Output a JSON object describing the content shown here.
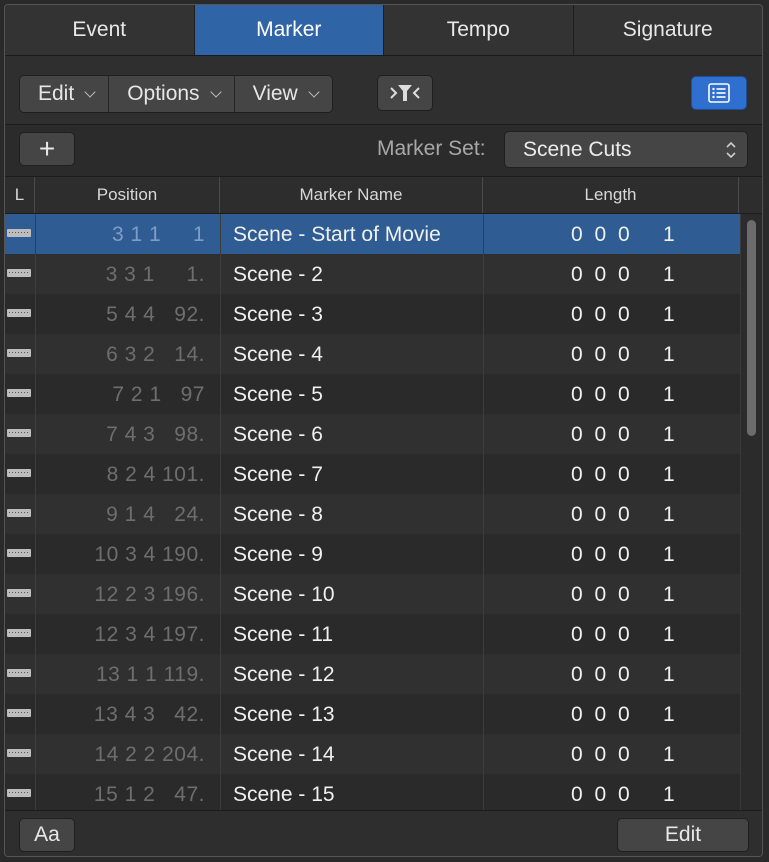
{
  "tabs": [
    {
      "label": "Event",
      "active": false
    },
    {
      "label": "Marker",
      "active": true
    },
    {
      "label": "Tempo",
      "active": false
    },
    {
      "label": "Signature",
      "active": false
    }
  ],
  "toolbar": {
    "edit_label": "Edit",
    "options_label": "Options",
    "view_label": "View",
    "filter_icon": "catch-filter-icon",
    "list_icon": "list-view-icon"
  },
  "subbar": {
    "add_label": "+",
    "marker_set_label": "Marker Set:",
    "marker_set_value": "Scene Cuts"
  },
  "table": {
    "headers": {
      "lock": "L",
      "position": "Position",
      "name": "Marker Name",
      "length": "Length"
    },
    "selected_index": 0,
    "rows": [
      {
        "position": "3 1 1     1",
        "name": "Scene - Start of Movie",
        "length": "0 0 0",
        "length_ticks": "1"
      },
      {
        "position": "3 3 1     1.",
        "name": "Scene - 2",
        "length": "0 0 0",
        "length_ticks": "1"
      },
      {
        "position": "5 4 4   92.",
        "name": "Scene - 3",
        "length": "0 0 0",
        "length_ticks": "1"
      },
      {
        "position": "6 3 2   14.",
        "name": "Scene - 4",
        "length": "0 0 0",
        "length_ticks": "1"
      },
      {
        "position": "7 2 1   97",
        "name": "Scene - 5",
        "length": "0 0 0",
        "length_ticks": "1"
      },
      {
        "position": "7 4 3   98.",
        "name": "Scene - 6",
        "length": "0 0 0",
        "length_ticks": "1"
      },
      {
        "position": "8 2 4 101.",
        "name": "Scene - 7",
        "length": "0 0 0",
        "length_ticks": "1"
      },
      {
        "position": "9 1 4   24.",
        "name": "Scene - 8",
        "length": "0 0 0",
        "length_ticks": "1"
      },
      {
        "position": "10 3 4 190.",
        "name": "Scene - 9",
        "length": "0 0 0",
        "length_ticks": "1"
      },
      {
        "position": "12 2 3 196.",
        "name": "Scene - 10",
        "length": "0 0 0",
        "length_ticks": "1"
      },
      {
        "position": "12 3 4 197.",
        "name": "Scene - 11",
        "length": "0 0 0",
        "length_ticks": "1"
      },
      {
        "position": "13 1 1 119.",
        "name": "Scene - 12",
        "length": "0 0 0",
        "length_ticks": "1"
      },
      {
        "position": "13 4 3   42.",
        "name": "Scene - 13",
        "length": "0 0 0",
        "length_ticks": "1"
      },
      {
        "position": "14 2 2 204.",
        "name": "Scene - 14",
        "length": "0 0 0",
        "length_ticks": "1"
      },
      {
        "position": "15 1 2   47.",
        "name": "Scene - 15",
        "length": "0 0 0",
        "length_ticks": "1"
      }
    ]
  },
  "footer": {
    "text_size_label": "Aa",
    "edit_label": "Edit"
  },
  "colors": {
    "accent": "#2f64a6",
    "selected_row": "#2e5c93",
    "button_blue": "#2f6fd0"
  }
}
